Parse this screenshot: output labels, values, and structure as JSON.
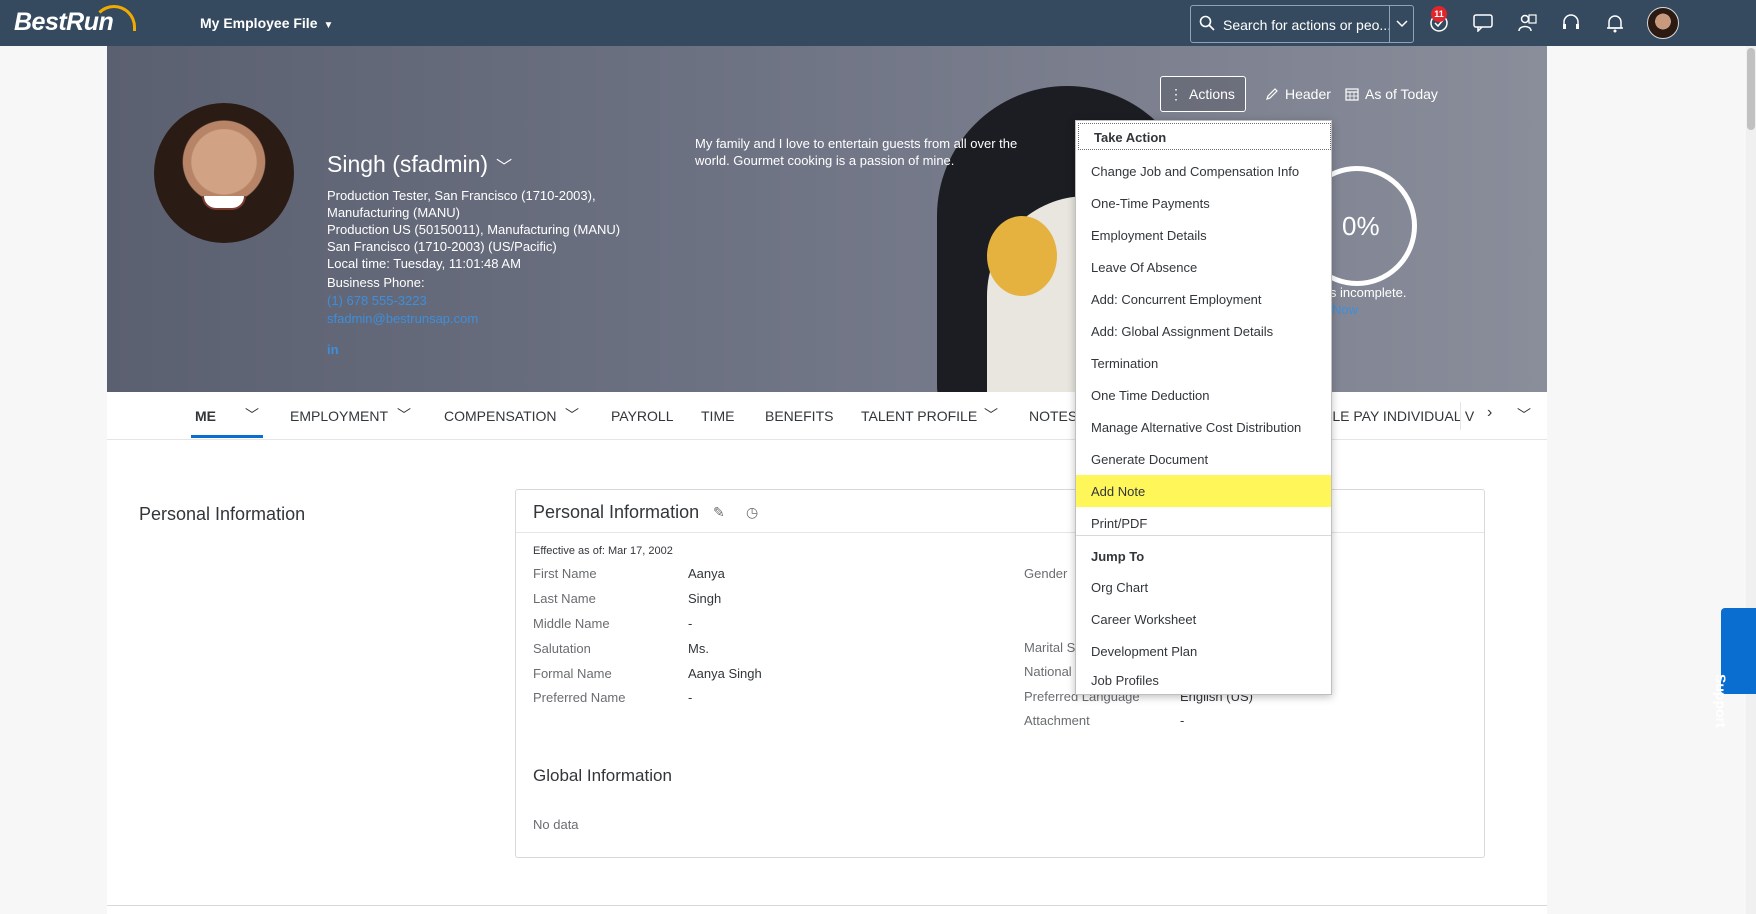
{
  "shell": {
    "logo": "BestRun",
    "app_title": "My Employee File",
    "search_placeholder": "Search for actions or peo...",
    "notification_count": "11",
    "icons": [
      "todo-icon",
      "feedback-icon",
      "people-icon",
      "headset-icon",
      "bell-icon"
    ]
  },
  "header": {
    "name": "Singh (sfadmin)",
    "lines": [
      "Production Tester, San Francisco (1710-2003),",
      "Manufacturing (MANU)",
      "Production US (50150011), Manufacturing (MANU)",
      "San Francisco (1710-2003) (US/Pacific)",
      "Local time: Tuesday, 11:01:48 AM",
      "Business Phone:"
    ],
    "phone": " (1) 678 555-3223",
    "email": "sfadmin@bestrunsap.com",
    "linkedin": "in",
    "bio": "My family and I love to entertain guests from all over the world. Gourmet cooking is a passion of mine.",
    "profile_percent": "0%",
    "profile_status": "is incomplete.",
    "profile_link": "Now",
    "actions_label": "Actions",
    "header_label": "Header",
    "as_of_label": "As of Today"
  },
  "tabs": [
    {
      "label": "ME"
    },
    {
      "label": "EMPLOYMENT"
    },
    {
      "label": "COMPENSATION"
    },
    {
      "label": "PAYROLL"
    },
    {
      "label": "TIME"
    },
    {
      "label": "BENEFITS"
    },
    {
      "label": "TALENT PROFILE"
    },
    {
      "label": "NOTES"
    },
    {
      "label": "BLE PAY INDIVIDUAL V"
    }
  ],
  "page": {
    "section_title": "Personal Information",
    "card_title": "Personal Information",
    "effective": "Effective as of: Mar 17, 2002",
    "fields_left": [
      {
        "label": "First Name",
        "value": "Aanya"
      },
      {
        "label": "Last Name",
        "value": "Singh"
      },
      {
        "label": "Middle Name",
        "value": "-"
      },
      {
        "label": "Salutation",
        "value": "Ms."
      },
      {
        "label": "Formal Name",
        "value": "Aanya Singh"
      },
      {
        "label": "Preferred Name",
        "value": "-"
      }
    ],
    "fields_right": [
      {
        "label": "Gender",
        "value": ""
      },
      {
        "label": "Marital S",
        "value": ""
      },
      {
        "label": "National",
        "value": ""
      },
      {
        "label": "Preferred Language",
        "value": "English (US)"
      },
      {
        "label": "Attachment",
        "value": "-"
      }
    ],
    "global_title": "Global Information",
    "no_data": "No data"
  },
  "menu": {
    "group1": "Take Action",
    "take_action": [
      "Change Job and Compensation Info",
      "One-Time Payments",
      "Employment Details",
      "Leave Of Absence",
      "Add: Concurrent Employment",
      "Add: Global Assignment Details",
      "Termination",
      "One Time Deduction",
      "Manage Alternative Cost Distribution",
      "Generate Document",
      "Add Note",
      "Print/PDF"
    ],
    "group2": "Jump To",
    "jump_to": [
      "Org Chart",
      "Career Worksheet",
      "Development Plan",
      "Job Profiles"
    ]
  },
  "support_label": "Support",
  "colors": {
    "shell": "#354a5f",
    "accent": "#0a6ed1",
    "highlight": "#fff65a",
    "logo_arc": "#f0ab00"
  }
}
